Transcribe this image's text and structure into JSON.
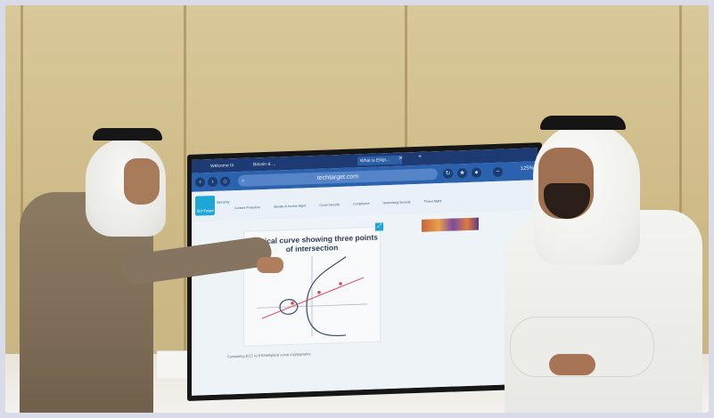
{
  "browser": {
    "tabs": [
      {
        "label": "Welcome to"
      },
      {
        "label": "Bitcoin & ..."
      },
      {
        "label": "What is Ellipt..."
      }
    ],
    "url": "techtarget.com",
    "zoom": "125%"
  },
  "site": {
    "logo_text": "TechTarget",
    "section_label": "Security",
    "nav": [
      "Content Protection",
      "Identity & Access Mgmt",
      "Cloud Security",
      "Compliance",
      "Networking Security",
      "Threat Mgmt"
    ]
  },
  "figure": {
    "title": "Elliptical curve showing three points of intersection"
  },
  "caption": "Comparing ECC to RSA/elliptical curve cryptography",
  "colors": {
    "wall": "#cdb985",
    "browser_chrome": "#1d3a73",
    "accent": "#1ea6d6"
  }
}
